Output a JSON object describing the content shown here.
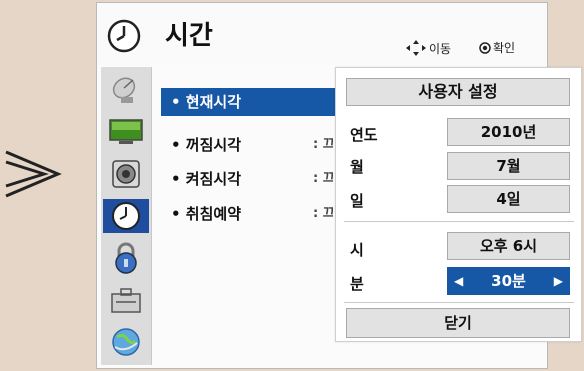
{
  "header": {
    "title": "시간",
    "hint_move": "이동",
    "hint_ok": "확인"
  },
  "sidebar": {
    "icons": [
      {
        "name": "satellite-dish-icon"
      },
      {
        "name": "tv-screen-icon"
      },
      {
        "name": "speaker-icon"
      },
      {
        "name": "clock-icon",
        "selected": true
      },
      {
        "name": "padlock-icon"
      },
      {
        "name": "toolbox-icon"
      },
      {
        "name": "network-globe-icon"
      }
    ]
  },
  "menu": {
    "items": [
      {
        "label": "• 현재시각",
        "selected": true,
        "value": ""
      },
      {
        "label": "• 꺼짐시각",
        "value": ": 끄"
      },
      {
        "label": "• 켜짐시각",
        "value": ": 끄"
      },
      {
        "label": "• 취침예약",
        "value": ": 끄"
      }
    ]
  },
  "popup": {
    "title": "사용자 설정",
    "fields": [
      {
        "label": "연도",
        "value": "2010년"
      },
      {
        "label": "월",
        "value": "7월"
      },
      {
        "label": "일",
        "value": "4일"
      },
      {
        "label": "시",
        "value": "오후 6시"
      },
      {
        "label": "분",
        "value": "30분",
        "active": true
      }
    ],
    "close_label": "닫기"
  },
  "colors": {
    "accent": "#1657a6",
    "background": "#e6d6c7"
  }
}
